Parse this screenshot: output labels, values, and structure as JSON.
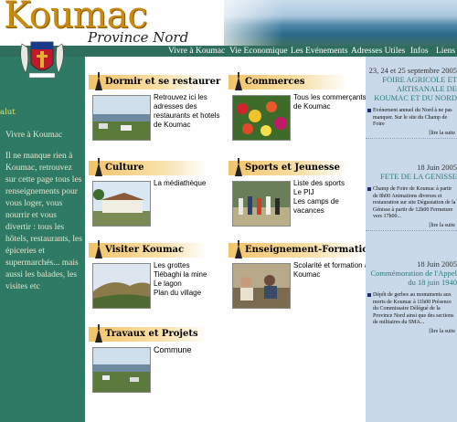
{
  "header": {
    "logo_title": "Koumac",
    "logo_subtitle": "Province Nord"
  },
  "nav": {
    "items": [
      {
        "label": "Vivre à Koumac"
      },
      {
        "label": "Vie Economique"
      },
      {
        "label": "Les Evénements"
      },
      {
        "label": "Adresses Utiles"
      },
      {
        "label": "Infos"
      },
      {
        "label": "Liens"
      }
    ]
  },
  "left": {
    "salut": "alut",
    "title": "Vivre à Koumac",
    "body": "Il ne manque rien à Koumac, retrouvez sur cette page tous les renseignements pour vous loger, vous nourrir et vous divertir : tous les hôtels, restaurants, les épiceries et supermarchés... mais aussi les balades, les visites etc"
  },
  "sections": [
    {
      "title": "Dormir et se restaurer",
      "lines": [
        "Retrouvez ici les",
        "adresses des",
        "restaurants et hotels",
        "de Koumac"
      ]
    },
    {
      "title": "Commerces",
      "lines": [
        "Tous les commerçants",
        "de Koumac"
      ]
    },
    {
      "title": "Culture",
      "lines": [
        "La médiathèque"
      ]
    },
    {
      "title": "Sports et Jeunesse",
      "lines": [
        "Liste des sports",
        "Le PIJ",
        "Les camps de",
        "vacances"
      ]
    },
    {
      "title": "Visiter Koumac",
      "lines": [
        "Les grottes",
        "Tiébaghi la mine",
        "Le lagon",
        "Plan du village"
      ]
    },
    {
      "title": "Enseignement-Formation",
      "lines": [
        "Scolarité et formation à",
        "Koumac"
      ]
    },
    {
      "title": "Travaux et Projets",
      "lines": [
        "Commune"
      ]
    }
  ],
  "news": [
    {
      "date": "23, 24 et 25 septembre 2005",
      "title": "FOIRE AGRICOLE ET ARTISANALE DE KOUMAC ET DU NORD",
      "body": "Evénement annuel du Nord à ne pas manquer. Sur le site du Champ de Foire",
      "more": "[lire la suite"
    },
    {
      "date": "18 Juin 2005",
      "title": "FETE DE LA GENISSE",
      "body": "Champ de Foire de Koumac à partir de 8h00 Animations diverses et restauration sur site Dégustation de la Génisse à partir de 12h00 Fermeture vers 17h00...",
      "more": "[lire la suite"
    },
    {
      "date": "18 Juin 2005",
      "title": "Commémoration de l'Appel du 18 juin 1940",
      "body": "Dépôt de gerbes au monuments aux morts de Koumac à 11h00 Présence du Commissaire Délégué de la Province Nord ainsi que des sections de militaires du SMA...",
      "more": "[lire la suite"
    }
  ],
  "colors": {
    "left_green": "#2f7a64",
    "nav_green": "#2f6e5c",
    "right_blue": "#c9d9ea",
    "section_gold": "#f2c46a",
    "logo_gold": "#c98a10"
  }
}
